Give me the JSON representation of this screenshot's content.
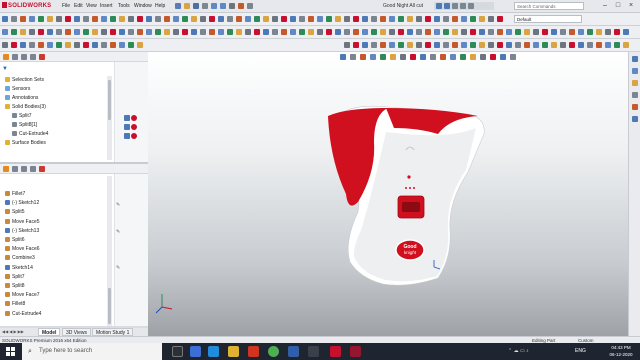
{
  "app": {
    "brand": "SOLIDWORKS",
    "menus": [
      "File",
      "Edit",
      "View",
      "Insert",
      "Tools",
      "Window",
      "Help"
    ],
    "doc_title": "Good Night All cut",
    "search_placeholder": "Search Commands",
    "config": "Default"
  },
  "feature_tree_top": {
    "items": [
      {
        "label": "Selection Sets",
        "icon": "folder-icon"
      },
      {
        "label": "Sensors",
        "icon": "sensor-icon"
      },
      {
        "label": "Annotations",
        "icon": "annotation-icon"
      },
      {
        "label": "Solid Bodies(3)",
        "icon": "folder-icon"
      },
      {
        "label": "Split7",
        "icon": "body-icon"
      },
      {
        "label": "Split8[1]",
        "icon": "body-icon"
      },
      {
        "label": "Cut-Extrude4",
        "icon": "body-icon"
      },
      {
        "label": "Surface Bodies",
        "icon": "folder-icon"
      }
    ]
  },
  "feature_tree_bottom": {
    "items": [
      {
        "label": "Fillet7",
        "icon": "feature-icon"
      },
      {
        "label": "(-) Sketch12",
        "icon": "sketch-icon"
      },
      {
        "label": "Split5",
        "icon": "feature-icon"
      },
      {
        "label": "Move Face5",
        "icon": "feature-icon"
      },
      {
        "label": "(-) Sketch13",
        "icon": "sketch-icon"
      },
      {
        "label": "Split6",
        "icon": "feature-icon"
      },
      {
        "label": "Move Face6",
        "icon": "feature-icon"
      },
      {
        "label": "Combine3",
        "icon": "feature-icon"
      },
      {
        "label": "Sketch14",
        "icon": "sketch-icon"
      },
      {
        "label": "Split7",
        "icon": "feature-icon"
      },
      {
        "label": "Split8",
        "icon": "feature-icon"
      },
      {
        "label": "Move Face7",
        "icon": "feature-icon"
      },
      {
        "label": "Fillet8",
        "icon": "feature-icon"
      },
      {
        "label": "Cut-Extrude4",
        "icon": "feature-icon"
      }
    ]
  },
  "sheet_tabs": [
    "Model",
    "3D Views",
    "Motion Study 1"
  ],
  "status_bar": {
    "left": "SOLIDWORKS Premium 2016 x64 Edition",
    "mode": "Editing Part",
    "units": "Custom"
  },
  "product_logo": {
    "line1": "Good",
    "line2": "knight"
  },
  "taskbar": {
    "search_placeholder": "Type here to search",
    "language": "ENG",
    "time": "04:43 PM",
    "date": "06-12-2020"
  },
  "colors": {
    "accent_red": "#d0101e",
    "viewport_bg": "#c7cbcf",
    "taskbar": "#1f2530"
  }
}
